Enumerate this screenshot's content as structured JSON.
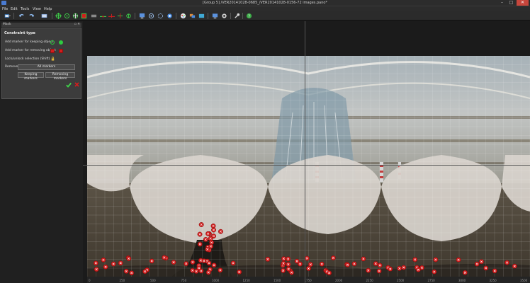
{
  "window": {
    "title": "[Group 5] /VER20141028-0685_/VER20141028-0156-72 images.pano*",
    "minimize": "–",
    "maximize": "□",
    "close": "✕"
  },
  "menu": [
    {
      "label": "File"
    },
    {
      "label": "Edit"
    },
    {
      "label": "Tools"
    },
    {
      "label": "View"
    },
    {
      "label": "Help"
    }
  ],
  "toolbar": {
    "icons": [
      "open-project-icon",
      "save-icon",
      "undo-icon",
      "redo-icon",
      "image-list-icon",
      "crosshair-icon",
      "move-icon",
      "target-icon",
      "mask-icon",
      "level-icon",
      "line-icon",
      "straighten-icon",
      "rotate-icon",
      "circle-icon",
      "display-icon",
      "fit-icon",
      "points-icon",
      "color-icon",
      "palette-icon",
      "screens-icon",
      "monitor-icon",
      "settings-icon",
      "tools-icon",
      "help-icon"
    ]
  },
  "panel": {
    "title": "Mask",
    "header_buttons": "▫ ✕",
    "group_title": "Constraint type",
    "add_keep_label": "Add marker for keeping object",
    "add_remove_label": "Add marker for removing object",
    "lock_label": "Lock/unlock selection (Shift)",
    "remove_label": "Remove",
    "all_markers_button": "All markers",
    "keeping_markers_button": "Keeping markers",
    "removing_markers_button": "Removing markers"
  },
  "colors": {
    "keep_marker": "#2ecc40",
    "remove_marker": "#d21d1d",
    "sky": "#b9bdc0",
    "floor": "#4e4538",
    "mask_overlay": "#d8d3cc",
    "grid": "#ffffff"
  },
  "ruler": {
    "ticks": [
      "0",
      "250",
      "500",
      "750",
      "1000",
      "1250",
      "1500",
      "1750",
      "2000",
      "2250",
      "2500",
      "2750",
      "3000",
      "3250",
      "3500"
    ]
  },
  "markers": {
    "type": "removing",
    "count": 95
  }
}
